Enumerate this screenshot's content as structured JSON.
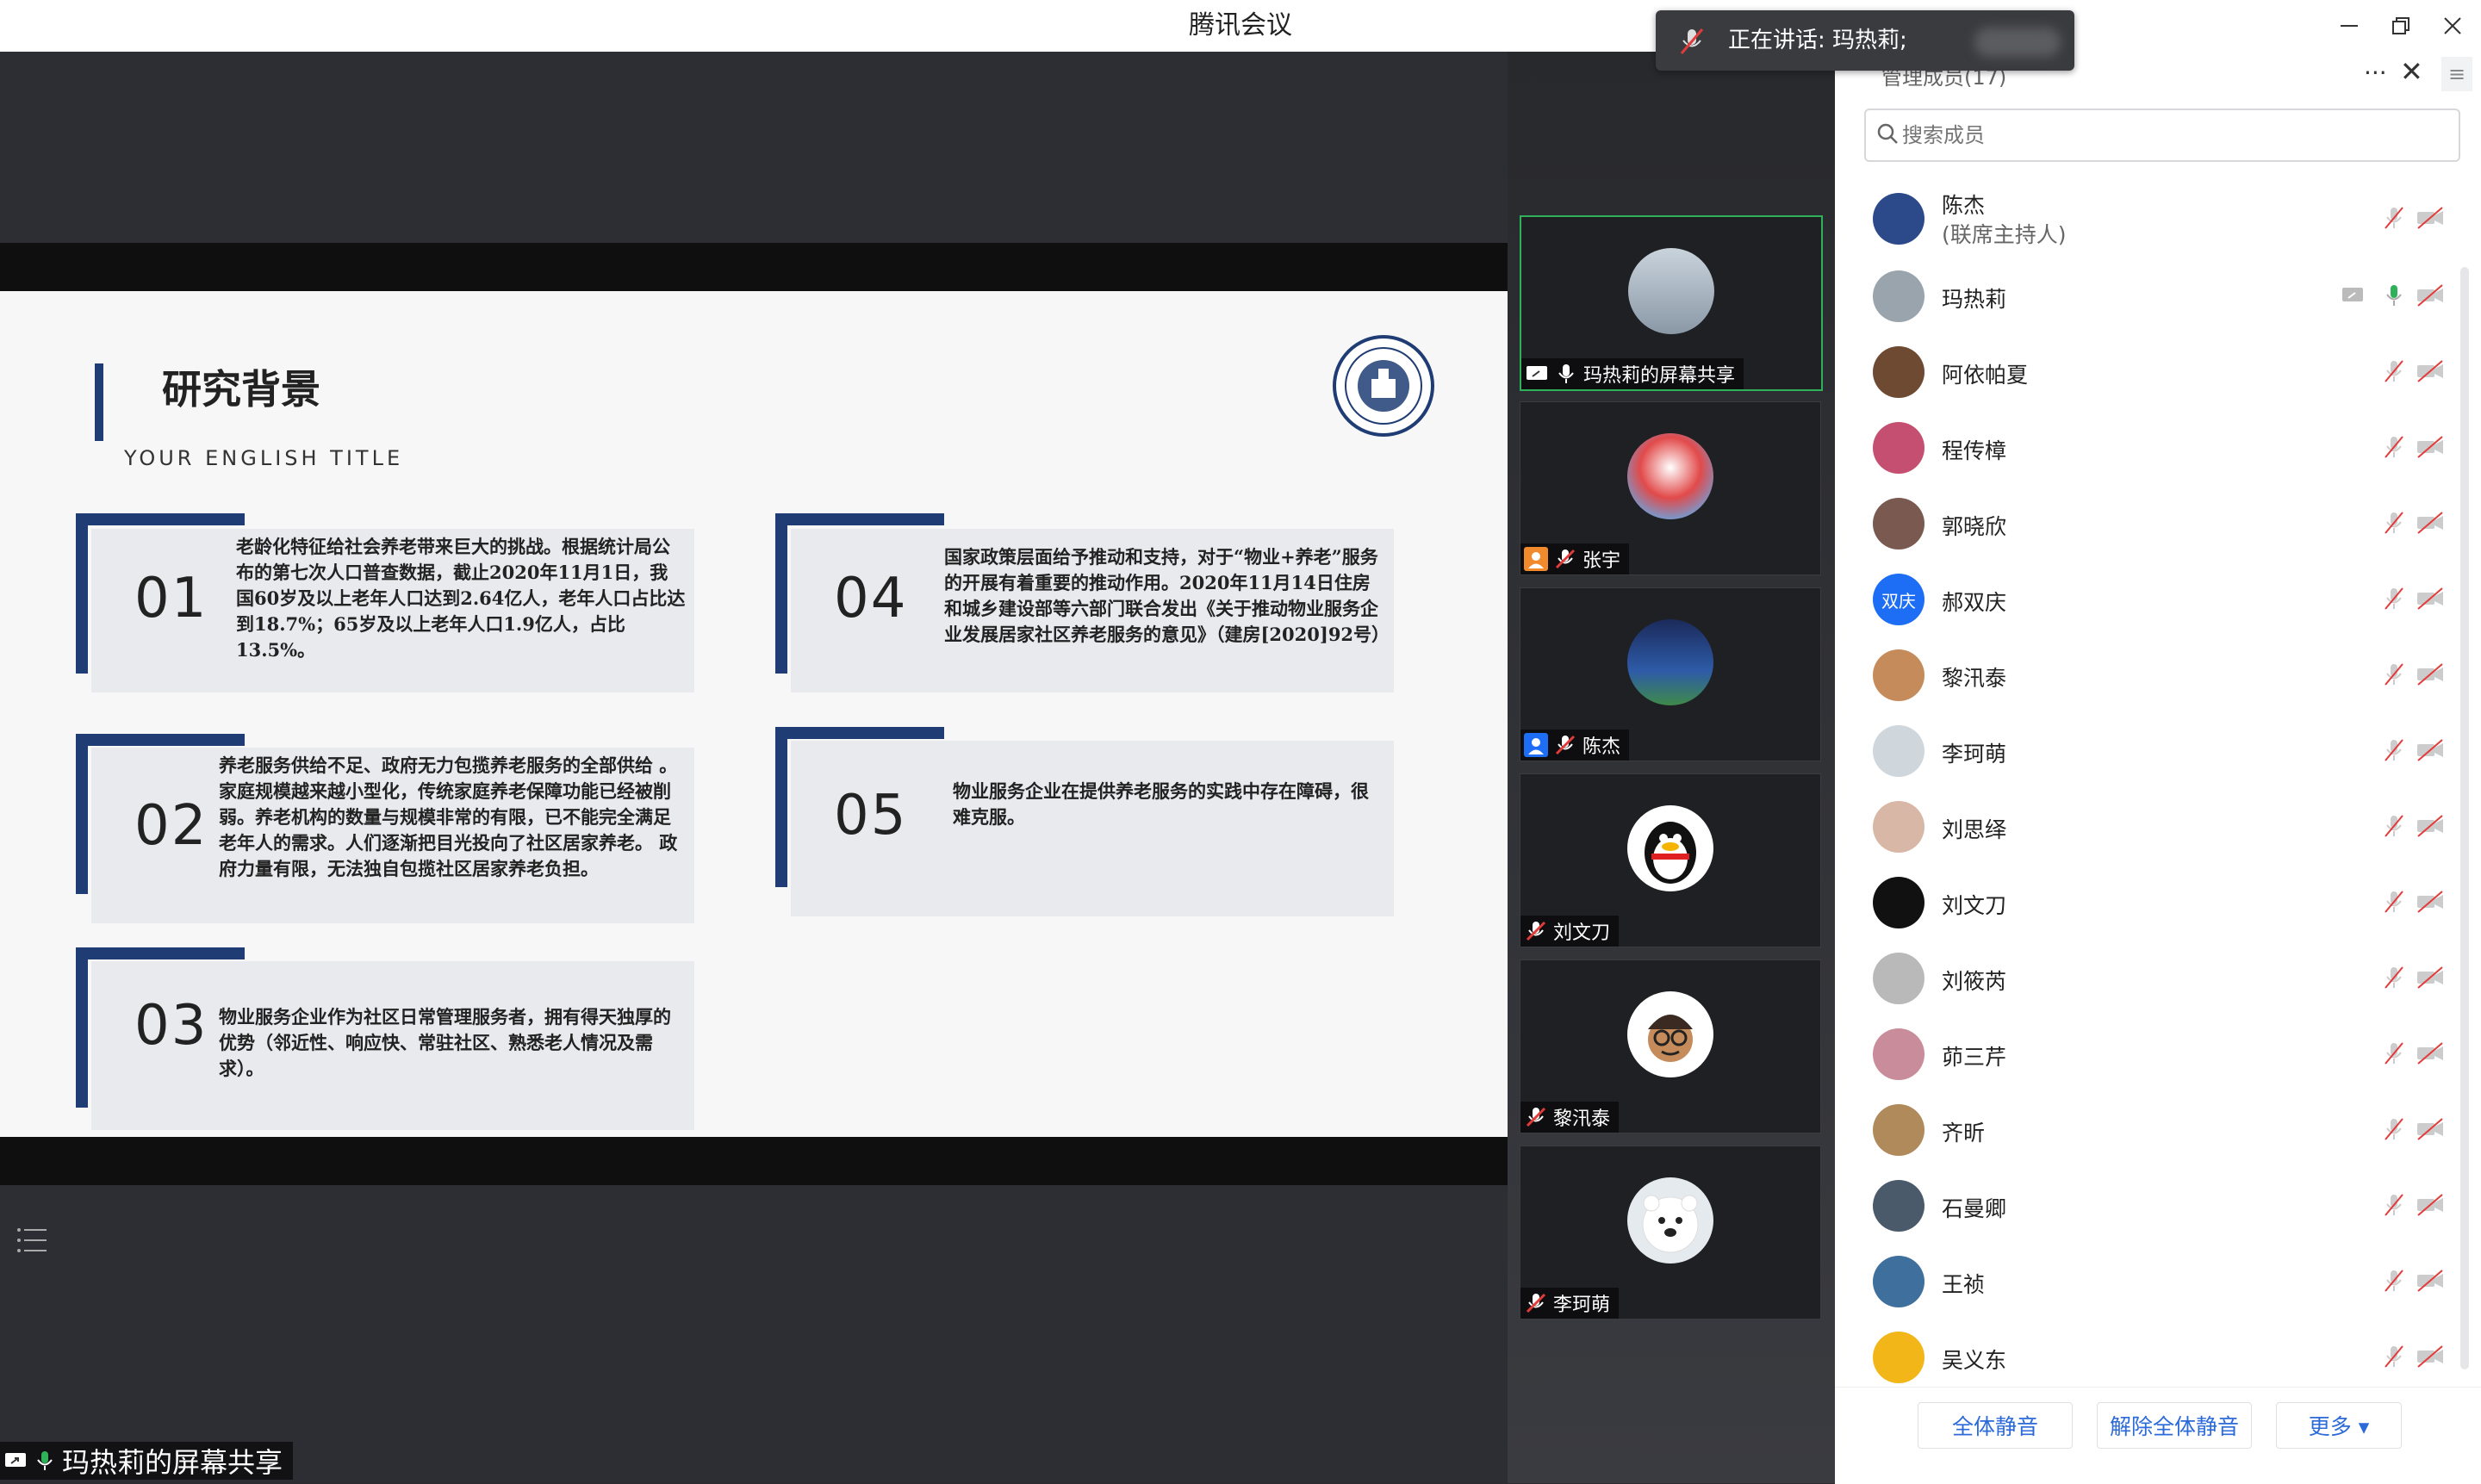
{
  "window": {
    "title": "腾讯会议",
    "minimize_icon": "minimize-icon",
    "restore_icon": "restore-icon",
    "close_icon": "close-icon"
  },
  "speaking_toast": {
    "text": "正在讲话: 玛热莉;"
  },
  "slide": {
    "title": "研究背景",
    "subtitle": "YOUR ENGLISH TITLE",
    "cards": [
      {
        "num": "01",
        "text": "老龄化特征给社会养老带来巨大的挑战。根据统计局公布的第七次人口普查数据，截止2020年11月1日，我国60岁及以上老年人口达到2.64亿人，老年人口占比达到18.7%；65岁及以上老年人口1.9亿人，占比13.5%。"
      },
      {
        "num": "02",
        "text": "养老服务供给不足、政府无力包揽养老服务的全部供给 。家庭规模越来越小型化，传统家庭养老保障功能已经被削弱。养老机构的数量与规模非常的有限，已不能完全满足老年人的需求。人们逐渐把目光投向了社区居家养老。 政府力量有限，无法独自包揽社区居家养老负担。"
      },
      {
        "num": "03",
        "text": "物业服务企业作为社区日常管理服务者，拥有得天独厚的优势（邻近性、响应快、常驻社区、熟悉老人情况及需求）。"
      },
      {
        "num": "04",
        "text": "国家政策层面给予推动和支持，对于“物业+养老”服务的开展有着重要的推动作用。2020年11月14日住房和城乡建设部等六部门联合发出《关于推动物业服务企业发展居家社区养老服务的意见》（建房[2020]92号）"
      },
      {
        "num": "05",
        "text": "物业服务企业在提供养老服务的实践中存在障碍，很难克服。"
      }
    ]
  },
  "video_thumbs": [
    {
      "label": "玛热莉的屏幕共享",
      "active": true
    },
    {
      "label": "张宇"
    },
    {
      "label": "陈杰"
    },
    {
      "label": "刘文刀"
    },
    {
      "label": "黎汛泰"
    },
    {
      "label": "李珂萌"
    }
  ],
  "sidebar": {
    "title": "管理成员(17)",
    "search_placeholder": "搜索成员",
    "members": [
      {
        "name": "陈杰",
        "role": "(联席主持人)",
        "avatar_color": "#2c4a8a"
      },
      {
        "name": "玛热莉",
        "avatar_color": "#9aa4ad",
        "speaking": true
      },
      {
        "name": "阿依帕夏",
        "avatar_color": "#6e4a33"
      },
      {
        "name": "程传樟",
        "avatar_color": "#c44f70"
      },
      {
        "name": "郭晓欣",
        "avatar_color": "#7a5a50"
      },
      {
        "name": "郝双庆",
        "avatar_text": "双庆",
        "avatar_color": "#1e6ef5"
      },
      {
        "name": "黎汛泰",
        "avatar_color": "#c58b5a"
      },
      {
        "name": "李珂萌",
        "avatar_color": "#cfd6dc"
      },
      {
        "name": "刘思绎",
        "avatar_color": "#d9b7a6"
      },
      {
        "name": "刘文刀",
        "avatar_color": "#111111"
      },
      {
        "name": "刘筱芮",
        "avatar_color": "#b9b9b9"
      },
      {
        "name": "茆三芹",
        "avatar_color": "#c98c9a"
      },
      {
        "name": "齐昕",
        "avatar_color": "#b08a5a"
      },
      {
        "name": "石曼卿",
        "avatar_color": "#4a5a6a"
      },
      {
        "name": "王祯",
        "avatar_color": "#3f6f9c"
      },
      {
        "name": "吴义东",
        "avatar_color": "#f2b619"
      }
    ],
    "footer_buttons": {
      "mute_all": "全体静音",
      "unmute_all": "解除全体静音",
      "more": "更多 ▾"
    }
  },
  "presenter_label": "玛热莉的屏幕共享",
  "colors": {
    "accent": "#1f3d74",
    "link_blue": "#2b6ad8",
    "active_green": "#2fb15a"
  }
}
